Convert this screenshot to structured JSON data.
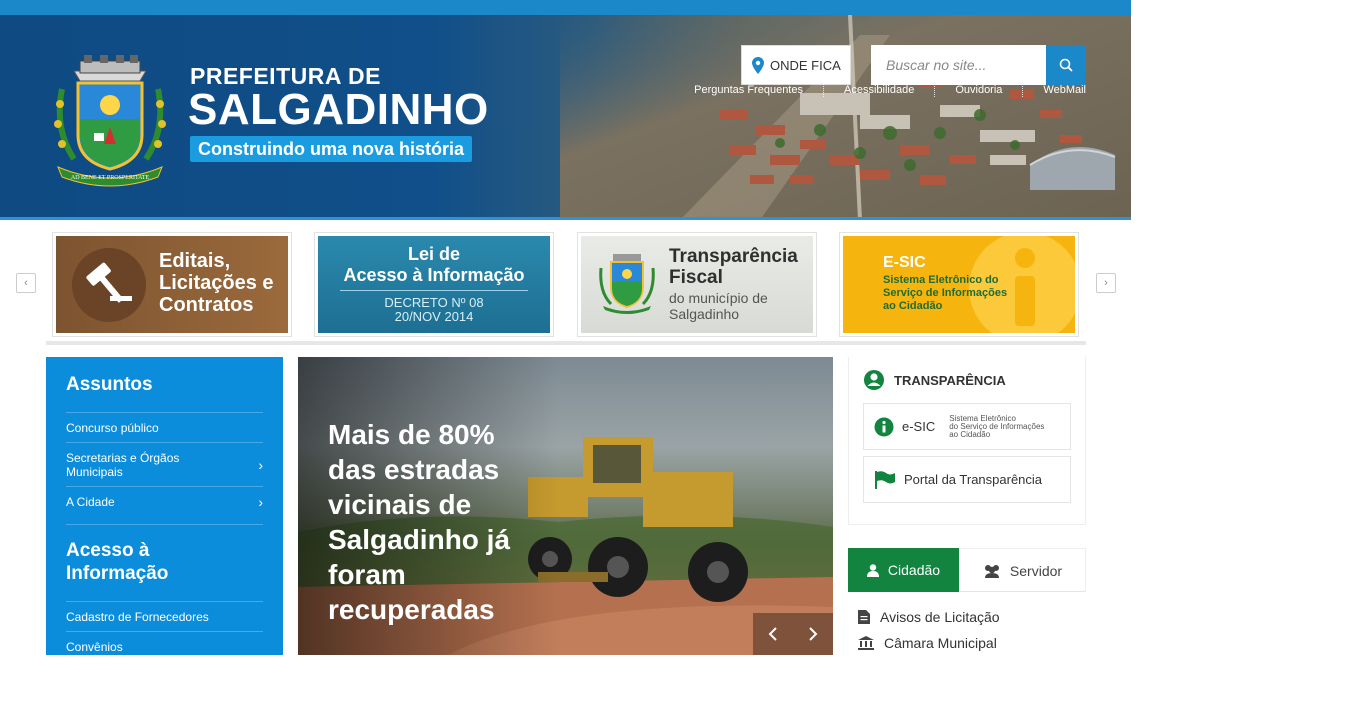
{
  "header": {
    "brand_line1": "PREFEITURA DE",
    "brand_line2": "SALGADINHO",
    "tagline": "Construindo uma nova história",
    "emblem_motto": "AD BENE ET PROSPERITATE",
    "onde_fica": "ONDE FICA",
    "search_placeholder": "Buscar no site...",
    "links": [
      "Perguntas Frequentes",
      "Acessibilidade",
      "Ouvidoria",
      "WebMail"
    ]
  },
  "banners": {
    "editais": {
      "line1": "Editais,",
      "line2": "Licitações e",
      "line3": "Contratos"
    },
    "lai": {
      "line1": "Lei de",
      "line2": "Acesso à Informação",
      "line3": "DECRETO Nº 08",
      "line4": "20/NOV 2014"
    },
    "fiscal": {
      "line1": "Transparência",
      "line2": "Fiscal",
      "line3": "do município de",
      "line4": "Salgadinho"
    },
    "esic": {
      "line1": "E-SIC",
      "line2": "Sistema Eletrônico do",
      "line3": "Serviço de Informações",
      "line4": "ao Cidadão"
    }
  },
  "sidebar": {
    "assuntos_title": "Assuntos",
    "assuntos": [
      {
        "label": "Concurso público",
        "chevron": false
      },
      {
        "label": "Secretarias e Órgãos Municipais",
        "chevron": true
      },
      {
        "label": "A Cidade",
        "chevron": true
      }
    ],
    "acesso_title": "Acesso à Informação",
    "acesso": [
      {
        "label": "Cadastro de Fornecedores"
      },
      {
        "label": "Convênios"
      }
    ]
  },
  "hero": {
    "title": "Mais de 80% das estradas vicinais de Salgadinho já foram recuperadas"
  },
  "transparencia": {
    "title": "TRANSPARÊNCIA",
    "esic_label": "e-SIC",
    "esic_small1": "Sistema Eletrônico",
    "esic_small2": "do Serviço de Informações",
    "esic_small3": "ao Cidadão",
    "portal_label": "Portal da Transparência"
  },
  "tabs": {
    "cidadao": "Cidadão",
    "servidor": "Servidor"
  },
  "links": [
    "Avisos de Licitação",
    "Câmara Municipal"
  ],
  "colors": {
    "primary_blue": "#1a88c9",
    "sidebar_blue": "#0b8ddb",
    "green": "#12843f",
    "esic_yellow": "#f4b400"
  }
}
